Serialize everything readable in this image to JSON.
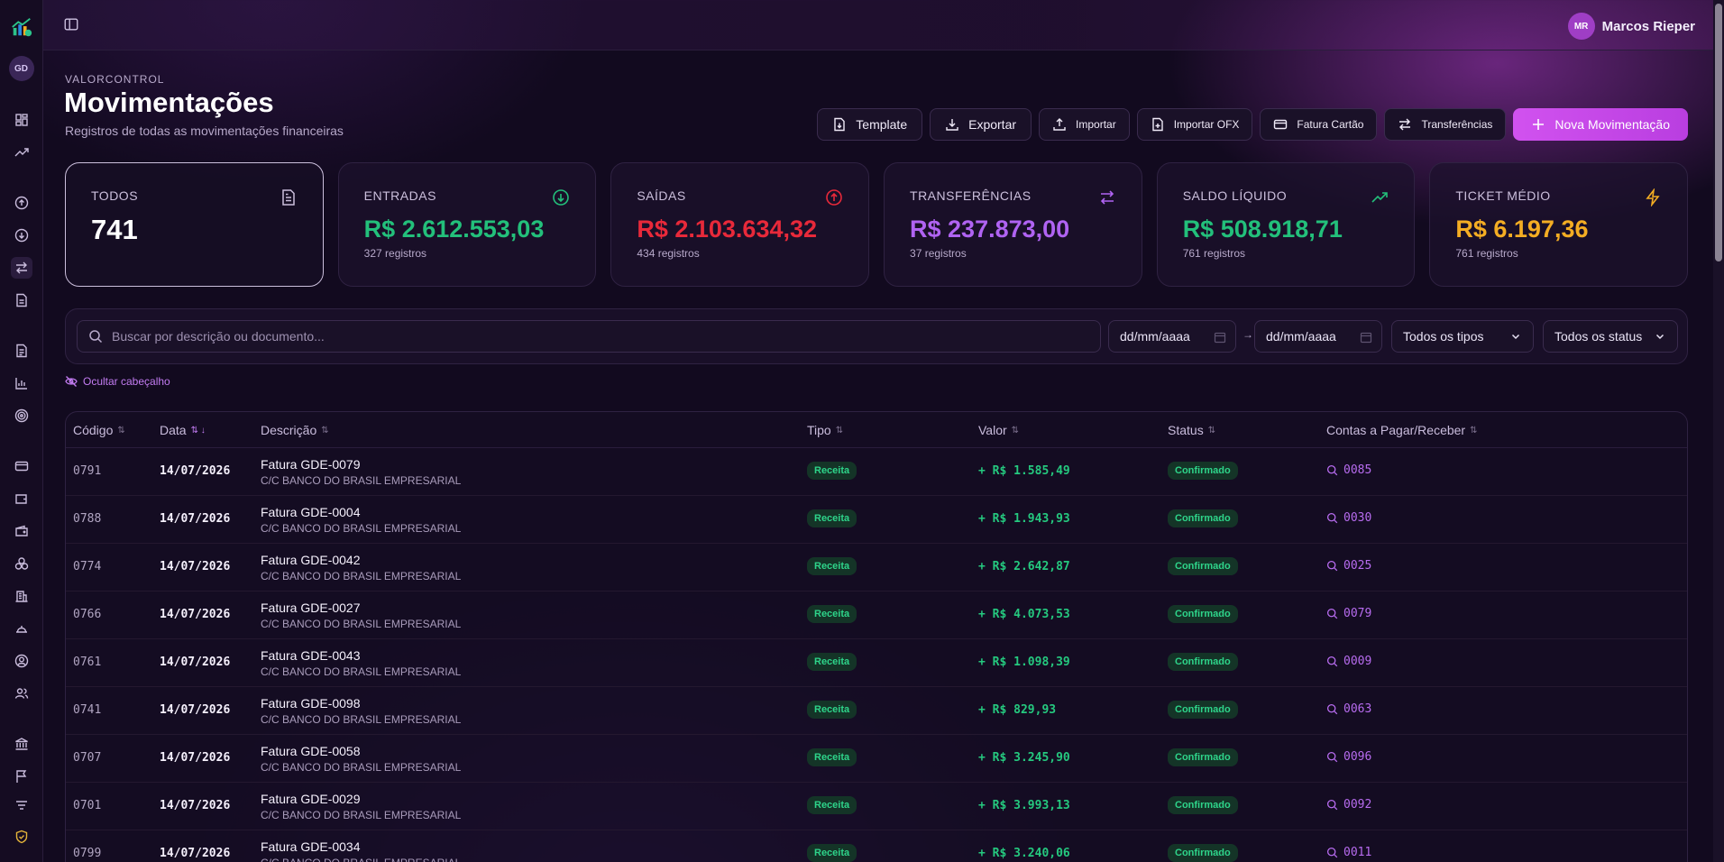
{
  "sidebar": {
    "workspace_initials": "GD",
    "items": [
      {
        "icon": "dashboard-icon"
      },
      {
        "icon": "trending-up-icon"
      },
      {
        "icon": "arrow-up-circle-icon"
      },
      {
        "icon": "arrow-down-circle-icon"
      },
      {
        "icon": "transfer-icon",
        "active": true
      },
      {
        "icon": "document-icon"
      },
      {
        "icon": "file-icon"
      },
      {
        "icon": "bar-chart-icon"
      },
      {
        "icon": "target-icon"
      },
      {
        "icon": "credit-card-icon"
      },
      {
        "icon": "wallet-icon"
      },
      {
        "icon": "wallet-alt-icon"
      },
      {
        "icon": "coins-icon"
      },
      {
        "icon": "building-icon"
      },
      {
        "icon": "hat-icon"
      },
      {
        "icon": "user-circle-icon"
      },
      {
        "icon": "users-icon"
      },
      {
        "icon": "bank-icon"
      },
      {
        "icon": "flag-icon"
      },
      {
        "icon": "filter-icon"
      },
      {
        "icon": "shield-icon"
      }
    ]
  },
  "topbar": {
    "user_initials": "MR",
    "user_name": "Marcos Rieper"
  },
  "header": {
    "eyebrow": "VALORCONTROL",
    "title": "Movimentações",
    "subtitle": "Registros de todas as movimentações financeiras"
  },
  "actions": {
    "template": "Template",
    "exportar": "Exportar",
    "importar": "Importar",
    "importar_ofx": "Importar OFX",
    "fatura_cartao": "Fatura Cartão",
    "transferencias": "Transferências",
    "nova": "Nova Movimentação"
  },
  "stats": {
    "todos": {
      "label": "TODOS",
      "value": "741"
    },
    "entradas": {
      "label": "ENTRADAS",
      "value": "R$ 2.612.553,03",
      "count": "327 registros",
      "color": "#23c07b"
    },
    "saidas": {
      "label": "SAÍDAS",
      "value": "R$ 2.103.634,32",
      "count": "434 registros",
      "color": "#e8293a"
    },
    "transferencias": {
      "label": "TRANSFERÊNCIAS",
      "value": "R$ 237.873,00",
      "count": "37 registros",
      "color": "#b063f2"
    },
    "saldo": {
      "label": "SALDO LÍQUIDO",
      "value": "R$ 508.918,71",
      "count": "761 registros",
      "color": "#23c07b"
    },
    "ticket": {
      "label": "TICKET MÉDIO",
      "value": "R$ 6.197,36",
      "count": "761 registros",
      "color": "#f4ad23"
    }
  },
  "filters": {
    "search_placeholder": "Buscar por descrição ou documento...",
    "date_from": "dd/mm/aaaa",
    "date_to": "dd/mm/aaaa",
    "date_separator": "→",
    "tipo": "Todos os tipos",
    "status": "Todos os status",
    "hide_header": "Ocultar cabeçalho"
  },
  "table": {
    "headers": {
      "codigo": "Código",
      "data": "Data",
      "descricao": "Descrição",
      "tipo": "Tipo",
      "valor": "Valor",
      "status": "Status",
      "contas": "Contas a Pagar/Receber"
    },
    "rows": [
      {
        "code": "0791",
        "date": "14/07/2026",
        "desc": "Fatura GDE-0079",
        "account": "C/C BANCO DO BRASIL EMPRESARIAL",
        "tipo": "Receita",
        "valor": "+ R$ 1.585,49",
        "status": "Confirmado",
        "conta": "0085"
      },
      {
        "code": "0788",
        "date": "14/07/2026",
        "desc": "Fatura GDE-0004",
        "account": "C/C BANCO DO BRASIL EMPRESARIAL",
        "tipo": "Receita",
        "valor": "+ R$ 1.943,93",
        "status": "Confirmado",
        "conta": "0030"
      },
      {
        "code": "0774",
        "date": "14/07/2026",
        "desc": "Fatura GDE-0042",
        "account": "C/C BANCO DO BRASIL EMPRESARIAL",
        "tipo": "Receita",
        "valor": "+ R$ 2.642,87",
        "status": "Confirmado",
        "conta": "0025"
      },
      {
        "code": "0766",
        "date": "14/07/2026",
        "desc": "Fatura GDE-0027",
        "account": "C/C BANCO DO BRASIL EMPRESARIAL",
        "tipo": "Receita",
        "valor": "+ R$ 4.073,53",
        "status": "Confirmado",
        "conta": "0079"
      },
      {
        "code": "0761",
        "date": "14/07/2026",
        "desc": "Fatura GDE-0043",
        "account": "C/C BANCO DO BRASIL EMPRESARIAL",
        "tipo": "Receita",
        "valor": "+ R$ 1.098,39",
        "status": "Confirmado",
        "conta": "0009"
      },
      {
        "code": "0741",
        "date": "14/07/2026",
        "desc": "Fatura GDE-0098",
        "account": "C/C BANCO DO BRASIL EMPRESARIAL",
        "tipo": "Receita",
        "valor": "+ R$ 829,93",
        "status": "Confirmado",
        "conta": "0063"
      },
      {
        "code": "0707",
        "date": "14/07/2026",
        "desc": "Fatura GDE-0058",
        "account": "C/C BANCO DO BRASIL EMPRESARIAL",
        "tipo": "Receita",
        "valor": "+ R$ 3.245,90",
        "status": "Confirmado",
        "conta": "0096"
      },
      {
        "code": "0701",
        "date": "14/07/2026",
        "desc": "Fatura GDE-0029",
        "account": "C/C BANCO DO BRASIL EMPRESARIAL",
        "tipo": "Receita",
        "valor": "+ R$ 3.993,13",
        "status": "Confirmado",
        "conta": "0092"
      },
      {
        "code": "0799",
        "date": "14/07/2026",
        "desc": "Fatura GDE-0034",
        "account": "C/C BANCO DO BRASIL EMPRESARIAL",
        "tipo": "Receita",
        "valor": "+ R$ 3.240,06",
        "status": "Confirmado",
        "conta": "0011"
      }
    ]
  },
  "colors": {
    "accent": "#c84ae8",
    "positive": "#23c07b",
    "negative": "#e8293a",
    "transfer": "#b063f2",
    "ticket": "#f4ad23"
  }
}
